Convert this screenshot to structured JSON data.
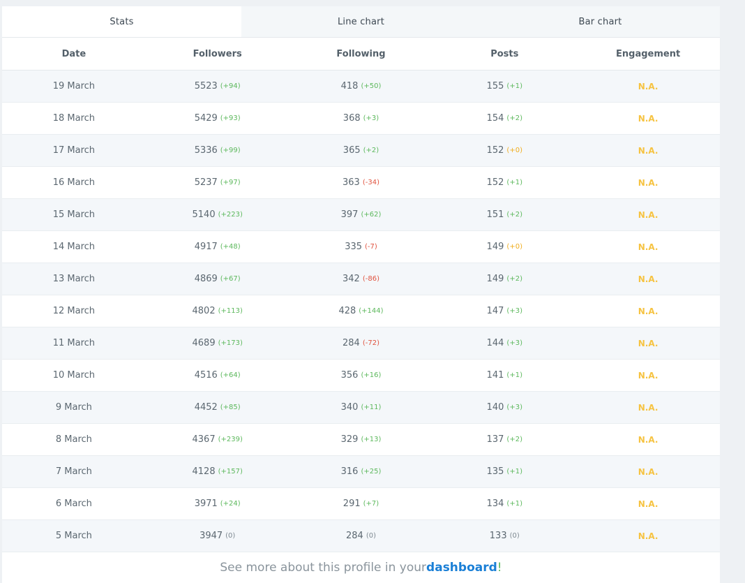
{
  "tabs": [
    {
      "label": "Stats",
      "active": true
    },
    {
      "label": "Line chart",
      "active": false
    },
    {
      "label": "Bar chart",
      "active": false
    }
  ],
  "columns": [
    "Date",
    "Followers",
    "Following",
    "Posts",
    "Engagement"
  ],
  "rows": [
    {
      "date": "19 March",
      "followers": "5523",
      "followers_delta": "(+94)",
      "following": "418",
      "following_delta": "(+50)",
      "posts": "155",
      "posts_delta": "(+1)",
      "engagement": "N.A."
    },
    {
      "date": "18 March",
      "followers": "5429",
      "followers_delta": "(+93)",
      "following": "368",
      "following_delta": "(+3)",
      "posts": "154",
      "posts_delta": "(+2)",
      "engagement": "N.A."
    },
    {
      "date": "17 March",
      "followers": "5336",
      "followers_delta": "(+99)",
      "following": "365",
      "following_delta": "(+2)",
      "posts": "152",
      "posts_delta": "(+0)",
      "engagement": "N.A."
    },
    {
      "date": "16 March",
      "followers": "5237",
      "followers_delta": "(+97)",
      "following": "363",
      "following_delta": "(-34)",
      "posts": "152",
      "posts_delta": "(+1)",
      "engagement": "N.A."
    },
    {
      "date": "15 March",
      "followers": "5140",
      "followers_delta": "(+223)",
      "following": "397",
      "following_delta": "(+62)",
      "posts": "151",
      "posts_delta": "(+2)",
      "engagement": "N.A."
    },
    {
      "date": "14 March",
      "followers": "4917",
      "followers_delta": "(+48)",
      "following": "335",
      "following_delta": "(-7)",
      "posts": "149",
      "posts_delta": "(+0)",
      "engagement": "N.A."
    },
    {
      "date": "13 March",
      "followers": "4869",
      "followers_delta": "(+67)",
      "following": "342",
      "following_delta": "(-86)",
      "posts": "149",
      "posts_delta": "(+2)",
      "engagement": "N.A."
    },
    {
      "date": "12 March",
      "followers": "4802",
      "followers_delta": "(+113)",
      "following": "428",
      "following_delta": "(+144)",
      "posts": "147",
      "posts_delta": "(+3)",
      "engagement": "N.A."
    },
    {
      "date": "11 March",
      "followers": "4689",
      "followers_delta": "(+173)",
      "following": "284",
      "following_delta": "(-72)",
      "posts": "144",
      "posts_delta": "(+3)",
      "engagement": "N.A."
    },
    {
      "date": "10 March",
      "followers": "4516",
      "followers_delta": "(+64)",
      "following": "356",
      "following_delta": "(+16)",
      "posts": "141",
      "posts_delta": "(+1)",
      "engagement": "N.A."
    },
    {
      "date": "9 March",
      "followers": "4452",
      "followers_delta": "(+85)",
      "following": "340",
      "following_delta": "(+11)",
      "posts": "140",
      "posts_delta": "(+3)",
      "engagement": "N.A."
    },
    {
      "date": "8 March",
      "followers": "4367",
      "followers_delta": "(+239)",
      "following": "329",
      "following_delta": "(+13)",
      "posts": "137",
      "posts_delta": "(+2)",
      "engagement": "N.A."
    },
    {
      "date": "7 March",
      "followers": "4128",
      "followers_delta": "(+157)",
      "following": "316",
      "following_delta": "(+25)",
      "posts": "135",
      "posts_delta": "(+1)",
      "engagement": "N.A."
    },
    {
      "date": "6 March",
      "followers": "3971",
      "followers_delta": "(+24)",
      "following": "291",
      "following_delta": "(+7)",
      "posts": "134",
      "posts_delta": "(+1)",
      "engagement": "N.A."
    },
    {
      "date": "5 March",
      "followers": "3947",
      "followers_delta": "(0)",
      "following": "284",
      "following_delta": "(0)",
      "posts": "133",
      "posts_delta": "(0)",
      "engagement": "N.A."
    }
  ],
  "footer": {
    "prefix": "See more about this profile in your ",
    "link": "dashboard",
    "suffix": "!"
  },
  "colors": {
    "positive": "#5cb85c",
    "negative": "#e0533f",
    "zero": "#f0ad1e",
    "na": "#f6c342",
    "link": "#1a7fd6"
  }
}
